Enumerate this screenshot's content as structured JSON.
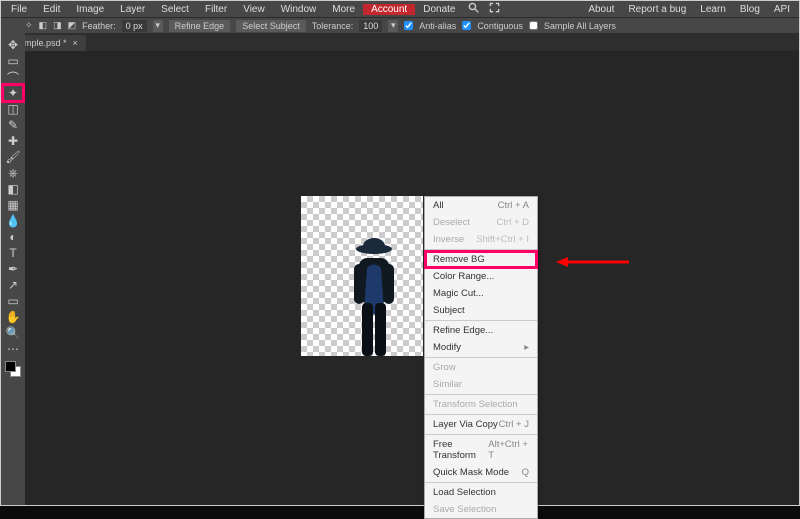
{
  "menus": {
    "file": "File",
    "edit": "Edit",
    "image": "Image",
    "layer": "Layer",
    "select": "Select",
    "filter": "Filter",
    "view": "View",
    "window": "Window",
    "more": "More",
    "account": "Account",
    "donate": "Donate"
  },
  "topRight": {
    "about": "About",
    "report": "Report a bug",
    "learn": "Learn",
    "blog": "Blog",
    "api": "API"
  },
  "options": {
    "featherLabel": "Feather:",
    "featherValue": "0 px",
    "refineEdge": "Refine Edge",
    "selectSubject": "Select Subject",
    "toleranceLabel": "Tolerance:",
    "toleranceValue": "100",
    "antiAlias": "Anti-alias",
    "contiguous": "Contiguous",
    "sampleAll": "Sample All Layers"
  },
  "tab": {
    "name": "Sample.psd *"
  },
  "contextMenu": [
    {
      "label": "All",
      "shortcut": "Ctrl + A",
      "dis": false
    },
    {
      "label": "Deselect",
      "shortcut": "Ctrl + D",
      "dis": true
    },
    {
      "label": "Inverse",
      "shortcut": "Shift+Ctrl + I",
      "dis": true
    },
    {
      "sep": true
    },
    {
      "label": "Remove BG",
      "highlight": true
    },
    {
      "label": "Color Range...",
      "dis": false
    },
    {
      "label": "Magic Cut...",
      "dis": false
    },
    {
      "label": "Subject",
      "dis": false
    },
    {
      "sep": true
    },
    {
      "label": "Refine Edge...",
      "dis": false
    },
    {
      "label": "Modify",
      "shortcut": "▸",
      "dis": false
    },
    {
      "sep": true
    },
    {
      "label": "Grow",
      "dis": true
    },
    {
      "label": "Similar",
      "dis": true
    },
    {
      "sep": true
    },
    {
      "label": "Transform Selection",
      "dis": true
    },
    {
      "sep": true
    },
    {
      "label": "Layer Via Copy",
      "shortcut": "Ctrl + J",
      "dis": false
    },
    {
      "sep": true
    },
    {
      "label": "Free Transform",
      "shortcut": "Alt+Ctrl + T",
      "dis": false
    },
    {
      "label": "Quick Mask Mode",
      "shortcut": "Q",
      "dis": false
    },
    {
      "sep": true
    },
    {
      "label": "Load Selection",
      "dis": false
    },
    {
      "label": "Save Selection",
      "dis": true
    }
  ]
}
